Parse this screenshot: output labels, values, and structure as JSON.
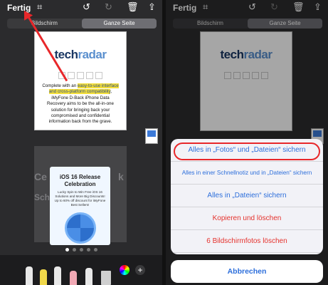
{
  "left": {
    "toolbar": {
      "done_label": "Fertig"
    },
    "segments": [
      "Bildschirm",
      "Ganze Seite"
    ],
    "doc": {
      "logo_main": "tech",
      "logo_accent": "radar",
      "text_before": "Complete with an ",
      "text_highlight": "easy-to-use interface and cross-platform compatibility",
      "text_after": ", iMyFone D-Back iPhone Data Recovery aims to be the all-in-one solution for bringing back your compromised and confidential information back from the grave."
    },
    "promo": {
      "title": "iOS 16 Release Celebration",
      "text": "Lucky Spin to Win Free iOS 16 Solutions and More Big Discounts! Up to 60% off discount for iMyFone Best Sellers!"
    },
    "ghost_left": "Ce",
    "ghost_left2": "Schirm",
    "ghost_right": "k"
  },
  "right": {
    "toolbar": {
      "done_label": "Fertig"
    },
    "segments": [
      "Bildschirm",
      "Ganze Seite"
    ],
    "doc": {
      "logo_main": "tech",
      "logo_accent": "radar"
    },
    "options": [
      "Alles in „Fotos“ und „Dateien“ sichern",
      "Alles in einer Schnellnotiz und in „Dateien“ sichern",
      "Alles in „Dateien“ sichern",
      "Kopieren und löschen",
      "6 Bildschirmfotos löschen"
    ],
    "cancel_label": "Abbrechen"
  },
  "colors": {
    "highlight_ring": "#e8272a",
    "ios_blue": "#2c6edb",
    "ios_red": "#e5322d"
  }
}
